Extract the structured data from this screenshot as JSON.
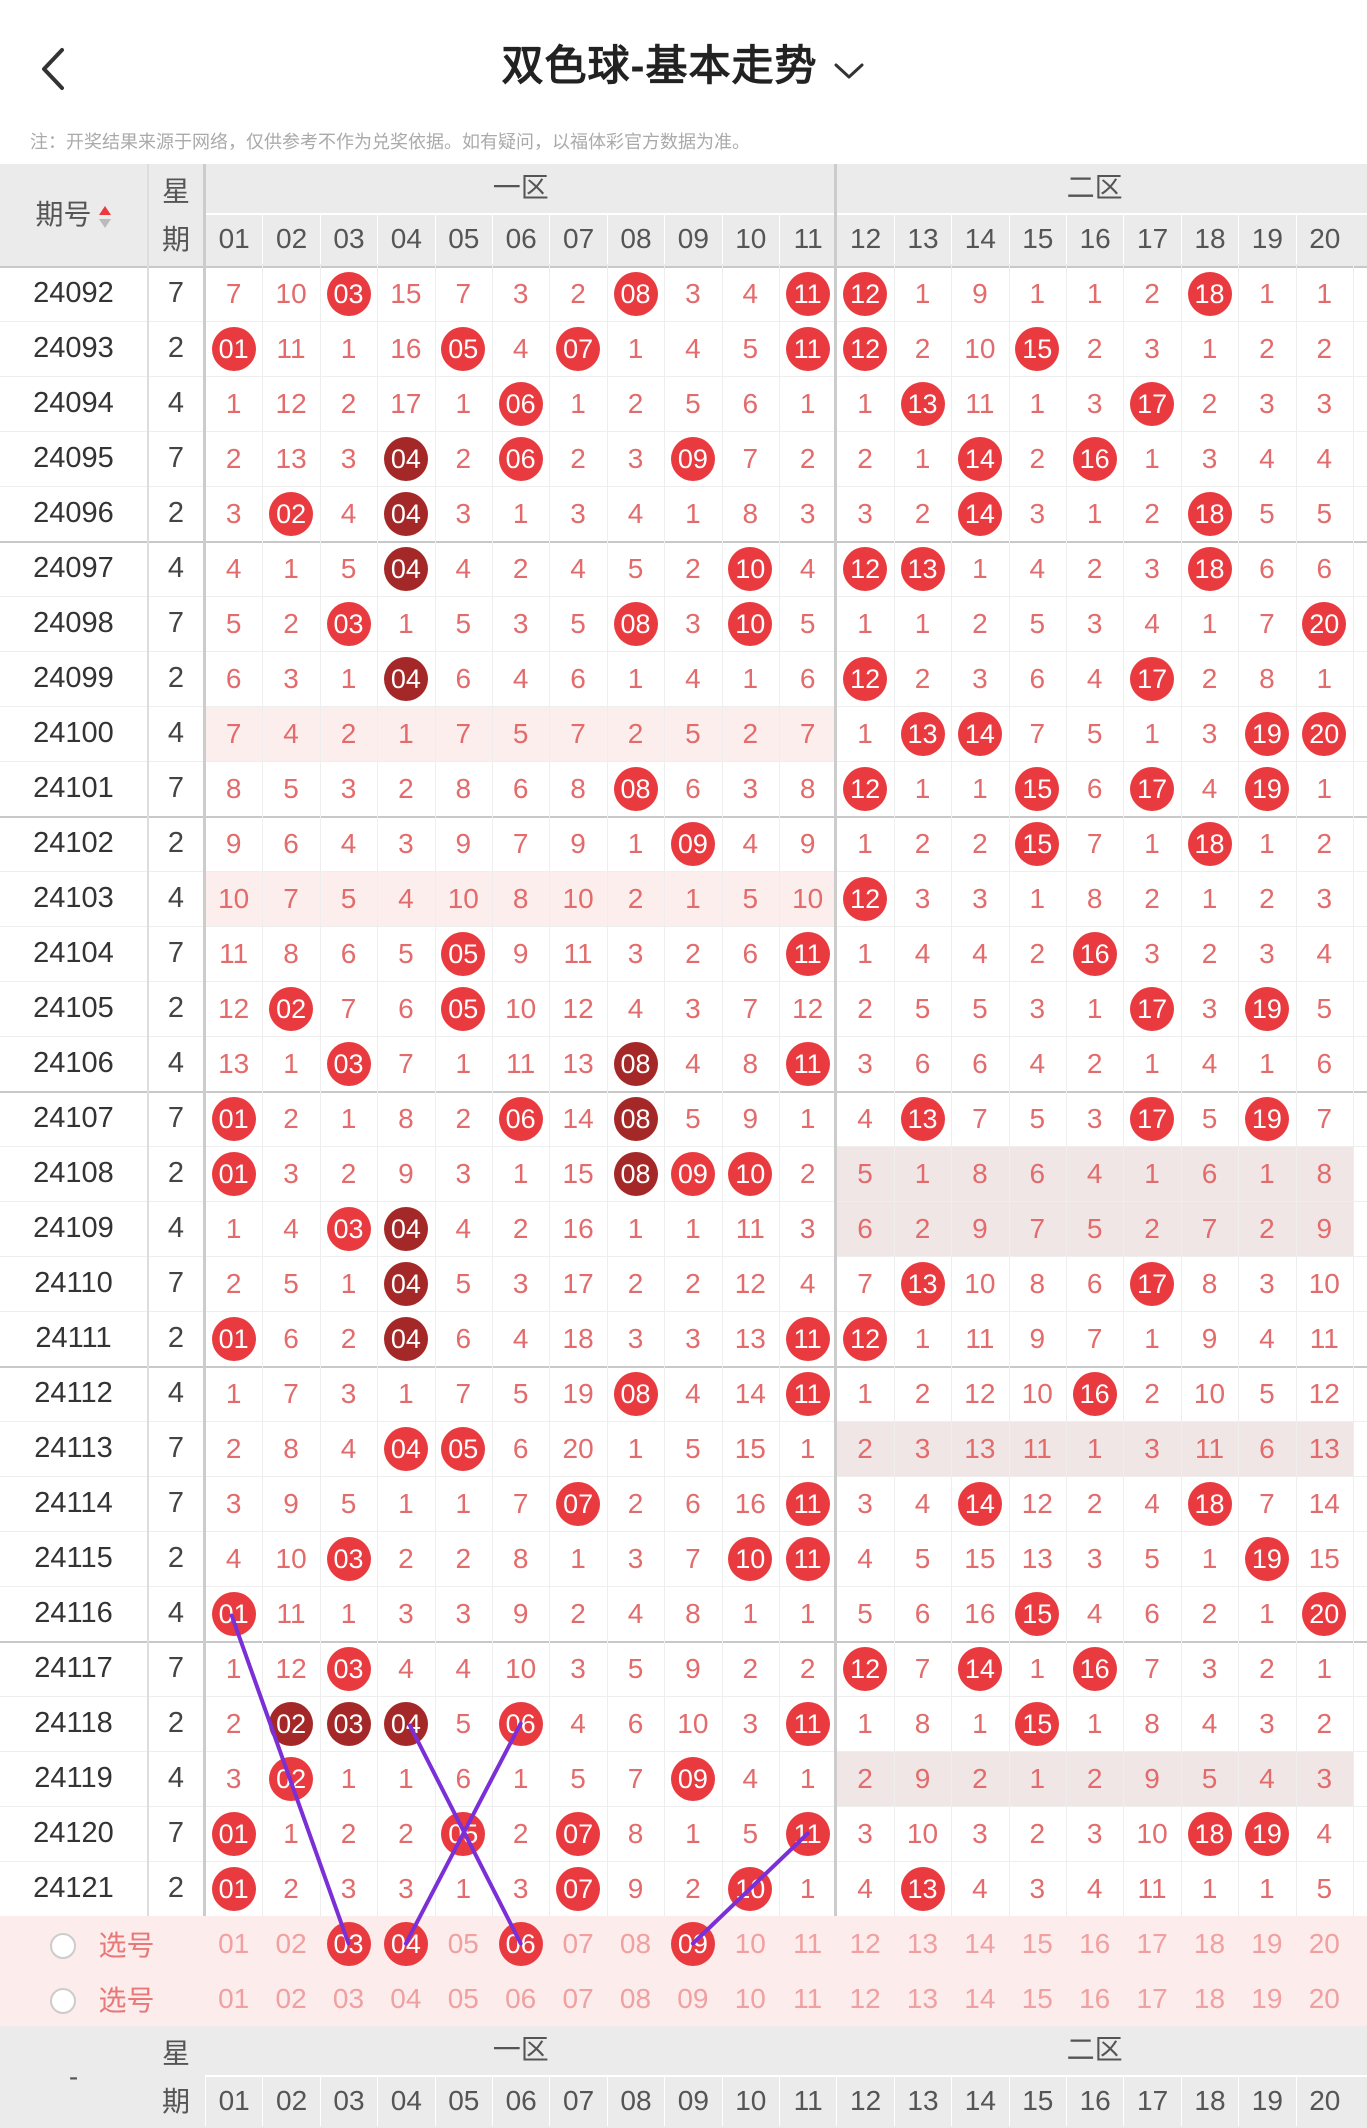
{
  "header": {
    "title": "双色球-基本走势"
  },
  "note": "注：开奖结果来源于网络，仅供参考不作为兑奖依据。如有疑问，以福体彩官方数据为准。",
  "table": {
    "col_issue": "期号",
    "col_week": "星期",
    "zone1": "一区",
    "zone2": "二区",
    "numbers": [
      "01",
      "02",
      "03",
      "04",
      "05",
      "06",
      "07",
      "08",
      "09",
      "10",
      "11",
      "12",
      "13",
      "14",
      "15",
      "16",
      "17",
      "18",
      "19",
      "20"
    ],
    "rows": [
      {
        "issue": "24092",
        "week": "7",
        "vals": [
          "7",
          "10",
          "03",
          "15",
          "7",
          "3",
          "2",
          "08",
          "3",
          "4",
          "11",
          "12",
          "1",
          "9",
          "1",
          "1",
          "2",
          "18",
          "1",
          "1"
        ]
      },
      {
        "issue": "24093",
        "week": "2",
        "vals": [
          "01",
          "11",
          "1",
          "16",
          "05",
          "4",
          "07",
          "1",
          "4",
          "5",
          "11",
          "12",
          "2",
          "10",
          "15",
          "2",
          "3",
          "1",
          "2",
          "2"
        ]
      },
      {
        "issue": "24094",
        "week": "4",
        "vals": [
          "1",
          "12",
          "2",
          "17",
          "1",
          "06",
          "1",
          "2",
          "5",
          "6",
          "1",
          "1",
          "13",
          "11",
          "1",
          "3",
          "17",
          "2",
          "3",
          "3"
        ]
      },
      {
        "issue": "24095",
        "week": "7",
        "vals": [
          "2",
          "13",
          "3",
          "04",
          "2",
          "06",
          "2",
          "3",
          "09",
          "7",
          "2",
          "2",
          "1",
          "14",
          "2",
          "16",
          "1",
          "3",
          "4",
          "4"
        ]
      },
      {
        "issue": "24096",
        "week": "2",
        "vals": [
          "3",
          "02",
          "4",
          "04",
          "3",
          "1",
          "3",
          "4",
          "1",
          "8",
          "3",
          "3",
          "2",
          "14",
          "3",
          "1",
          "2",
          "18",
          "5",
          "5"
        ]
      },
      {
        "issue": "24097",
        "week": "4",
        "vals": [
          "4",
          "1",
          "5",
          "04",
          "4",
          "2",
          "4",
          "5",
          "2",
          "10",
          "4",
          "12",
          "13",
          "1",
          "4",
          "2",
          "3",
          "18",
          "6",
          "6"
        ]
      },
      {
        "issue": "24098",
        "week": "7",
        "vals": [
          "5",
          "2",
          "03",
          "1",
          "5",
          "3",
          "5",
          "08",
          "3",
          "10",
          "5",
          "1",
          "1",
          "2",
          "5",
          "3",
          "4",
          "1",
          "7",
          "20"
        ]
      },
      {
        "issue": "24099",
        "week": "2",
        "vals": [
          "6",
          "3",
          "1",
          "04",
          "6",
          "4",
          "6",
          "1",
          "4",
          "1",
          "6",
          "12",
          "2",
          "3",
          "6",
          "4",
          "17",
          "2",
          "8",
          "1"
        ]
      },
      {
        "issue": "24100",
        "week": "4",
        "vals": [
          "7",
          "4",
          "2",
          "1",
          "7",
          "5",
          "7",
          "2",
          "5",
          "2",
          "7",
          "1",
          "13",
          "14",
          "7",
          "5",
          "1",
          "3",
          "19",
          "20"
        ]
      },
      {
        "issue": "24101",
        "week": "7",
        "vals": [
          "8",
          "5",
          "3",
          "2",
          "8",
          "6",
          "8",
          "08",
          "6",
          "3",
          "8",
          "12",
          "1",
          "1",
          "15",
          "6",
          "17",
          "4",
          "19",
          "1"
        ]
      },
      {
        "issue": "24102",
        "week": "2",
        "vals": [
          "9",
          "6",
          "4",
          "3",
          "9",
          "7",
          "9",
          "1",
          "09",
          "4",
          "9",
          "1",
          "2",
          "2",
          "15",
          "7",
          "1",
          "18",
          "1",
          "2"
        ]
      },
      {
        "issue": "24103",
        "week": "4",
        "vals": [
          "10",
          "7",
          "5",
          "4",
          "10",
          "8",
          "10",
          "2",
          "1",
          "5",
          "10",
          "12",
          "3",
          "3",
          "1",
          "8",
          "2",
          "1",
          "2",
          "3"
        ]
      },
      {
        "issue": "24104",
        "week": "7",
        "vals": [
          "11",
          "8",
          "6",
          "5",
          "05",
          "9",
          "11",
          "3",
          "2",
          "6",
          "11",
          "1",
          "4",
          "4",
          "2",
          "16",
          "3",
          "2",
          "3",
          "4"
        ]
      },
      {
        "issue": "24105",
        "week": "2",
        "vals": [
          "12",
          "02",
          "7",
          "6",
          "05",
          "10",
          "12",
          "4",
          "3",
          "7",
          "12",
          "2",
          "5",
          "5",
          "3",
          "1",
          "17",
          "3",
          "19",
          "5"
        ]
      },
      {
        "issue": "24106",
        "week": "4",
        "vals": [
          "13",
          "1",
          "03",
          "7",
          "1",
          "11",
          "13",
          "08",
          "4",
          "8",
          "11",
          "3",
          "6",
          "6",
          "4",
          "2",
          "1",
          "4",
          "1",
          "6"
        ]
      },
      {
        "issue": "24107",
        "week": "7",
        "vals": [
          "01",
          "2",
          "1",
          "8",
          "2",
          "06",
          "14",
          "08",
          "5",
          "9",
          "1",
          "4",
          "13",
          "7",
          "5",
          "3",
          "17",
          "5",
          "19",
          "7"
        ]
      },
      {
        "issue": "24108",
        "week": "2",
        "vals": [
          "01",
          "3",
          "2",
          "9",
          "3",
          "1",
          "15",
          "08",
          "09",
          "10",
          "2",
          "5",
          "1",
          "8",
          "6",
          "4",
          "1",
          "6",
          "1",
          "8"
        ]
      },
      {
        "issue": "24109",
        "week": "4",
        "vals": [
          "1",
          "4",
          "03",
          "04",
          "4",
          "2",
          "16",
          "1",
          "1",
          "11",
          "3",
          "6",
          "2",
          "9",
          "7",
          "5",
          "2",
          "7",
          "2",
          "9"
        ]
      },
      {
        "issue": "24110",
        "week": "7",
        "vals": [
          "2",
          "5",
          "1",
          "04",
          "5",
          "3",
          "17",
          "2",
          "2",
          "12",
          "4",
          "7",
          "13",
          "10",
          "8",
          "6",
          "17",
          "8",
          "3",
          "10"
        ]
      },
      {
        "issue": "24111",
        "week": "2",
        "vals": [
          "01",
          "6",
          "2",
          "04",
          "6",
          "4",
          "18",
          "3",
          "3",
          "13",
          "11",
          "12",
          "1",
          "11",
          "9",
          "7",
          "1",
          "9",
          "4",
          "11"
        ]
      },
      {
        "issue": "24112",
        "week": "4",
        "vals": [
          "1",
          "7",
          "3",
          "1",
          "7",
          "5",
          "19",
          "08",
          "4",
          "14",
          "11",
          "1",
          "2",
          "12",
          "10",
          "16",
          "2",
          "10",
          "5",
          "12"
        ]
      },
      {
        "issue": "24113",
        "week": "7",
        "vals": [
          "2",
          "8",
          "4",
          "04",
          "05",
          "6",
          "20",
          "1",
          "5",
          "15",
          "1",
          "2",
          "3",
          "13",
          "11",
          "1",
          "3",
          "11",
          "6",
          "13"
        ]
      },
      {
        "issue": "24114",
        "week": "7",
        "vals": [
          "3",
          "9",
          "5",
          "1",
          "1",
          "7",
          "07",
          "2",
          "6",
          "16",
          "11",
          "3",
          "4",
          "14",
          "12",
          "2",
          "4",
          "18",
          "7",
          "14"
        ]
      },
      {
        "issue": "24115",
        "week": "2",
        "vals": [
          "4",
          "10",
          "03",
          "2",
          "2",
          "8",
          "1",
          "3",
          "7",
          "10",
          "11",
          "4",
          "5",
          "15",
          "13",
          "3",
          "5",
          "1",
          "19",
          "15"
        ]
      },
      {
        "issue": "24116",
        "week": "4",
        "vals": [
          "01",
          "11",
          "1",
          "3",
          "3",
          "9",
          "2",
          "4",
          "8",
          "1",
          "1",
          "5",
          "6",
          "16",
          "15",
          "4",
          "6",
          "2",
          "1",
          "20"
        ]
      },
      {
        "issue": "24117",
        "week": "7",
        "vals": [
          "1",
          "12",
          "03",
          "4",
          "4",
          "10",
          "3",
          "5",
          "9",
          "2",
          "2",
          "12",
          "7",
          "14",
          "1",
          "16",
          "7",
          "3",
          "2",
          "1"
        ]
      },
      {
        "issue": "24118",
        "week": "2",
        "vals": [
          "2",
          "02",
          "03",
          "04",
          "5",
          "06",
          "4",
          "6",
          "10",
          "3",
          "11",
          "1",
          "8",
          "1",
          "15",
          "1",
          "8",
          "4",
          "3",
          "2"
        ]
      },
      {
        "issue": "24119",
        "week": "4",
        "vals": [
          "3",
          "02",
          "1",
          "1",
          "6",
          "1",
          "5",
          "7",
          "09",
          "4",
          "1",
          "2",
          "9",
          "2",
          "1",
          "2",
          "9",
          "5",
          "4",
          "3"
        ]
      },
      {
        "issue": "24120",
        "week": "7",
        "vals": [
          "01",
          "1",
          "2",
          "2",
          "05",
          "2",
          "07",
          "8",
          "1",
          "5",
          "11",
          "3",
          "10",
          "3",
          "2",
          "3",
          "10",
          "18",
          "19",
          "4"
        ]
      },
      {
        "issue": "24121",
        "week": "2",
        "vals": [
          "01",
          "2",
          "3",
          "3",
          "1",
          "3",
          "07",
          "9",
          "2",
          "10",
          "1",
          "4",
          "13",
          "4",
          "3",
          "4",
          "11",
          "1",
          "1",
          "5"
        ]
      }
    ],
    "select_rows": [
      {
        "label": "选号",
        "vals": [
          "01",
          "02",
          "03",
          "04",
          "05",
          "06",
          "07",
          "08",
          "09",
          "10",
          "11",
          "12",
          "13",
          "14",
          "15",
          "16",
          "17",
          "18",
          "19",
          "20"
        ]
      },
      {
        "label": "选号",
        "vals": [
          "01",
          "02",
          "03",
          "04",
          "05",
          "06",
          "07",
          "08",
          "09",
          "10",
          "11",
          "12",
          "13",
          "14",
          "15",
          "16",
          "17",
          "18",
          "19",
          "20"
        ]
      }
    ],
    "footer_issue": "-",
    "footer_week": "星期"
  },
  "colors": {
    "red": "#e83a3f",
    "darkred": "#a52828",
    "purple": "#7b2fd6",
    "pink_bg": "#fdecec"
  }
}
